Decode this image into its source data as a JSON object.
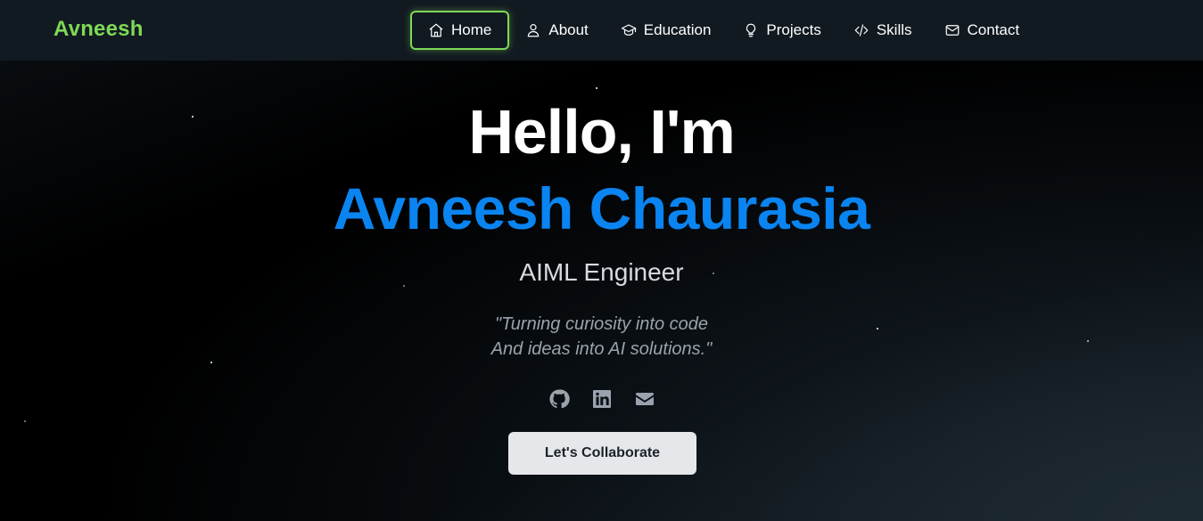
{
  "header": {
    "brand": "Avneesh",
    "nav": [
      {
        "label": "Home",
        "icon": "home-icon",
        "active": true
      },
      {
        "label": "About",
        "icon": "user-icon"
      },
      {
        "label": "Education",
        "icon": "graduation-cap-icon"
      },
      {
        "label": "Projects",
        "icon": "lightbulb-icon"
      },
      {
        "label": "Skills",
        "icon": "code-icon"
      },
      {
        "label": "Contact",
        "icon": "mail-icon"
      }
    ]
  },
  "hero": {
    "greeting": "Hello, I'm",
    "name": "Avneesh Chaurasia",
    "role": "AIML Engineer",
    "quote_line1": "\"Turning curiosity into code",
    "quote_line2": "And ideas into AI solutions.\"",
    "socials": [
      {
        "icon": "github-icon"
      },
      {
        "icon": "linkedin-icon"
      },
      {
        "icon": "envelope-icon"
      }
    ],
    "cta_label": "Let's Collaborate"
  },
  "colors": {
    "brand": "#7ed957",
    "name": "#0a84f0",
    "nav_bg": "#121a21"
  }
}
